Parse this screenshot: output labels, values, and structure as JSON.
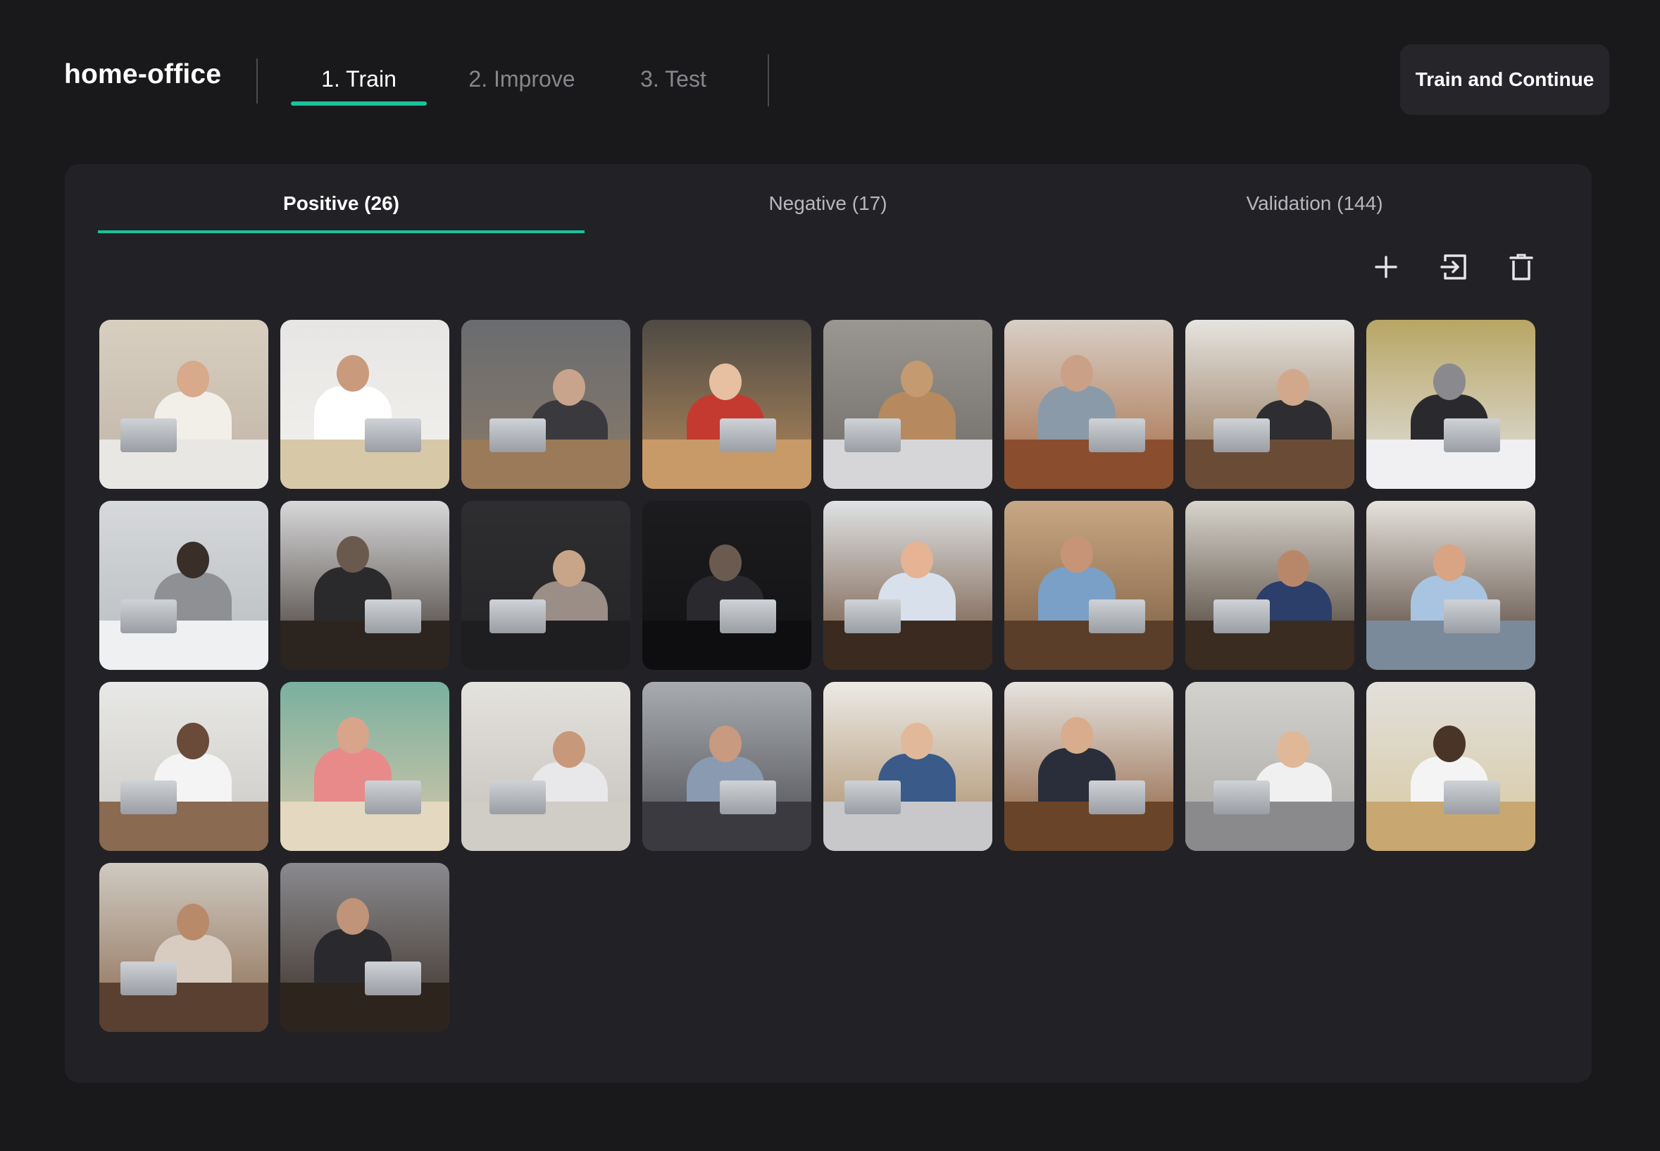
{
  "header": {
    "project_title": "home-office",
    "steps": [
      {
        "label": "1. Train",
        "active": true
      },
      {
        "label": "2. Improve",
        "active": false
      },
      {
        "label": "3. Test",
        "active": false
      }
    ],
    "primary_button": "Train and Continue"
  },
  "tabs": [
    {
      "label": "Positive (26)",
      "active": true
    },
    {
      "label": "Negative (17)",
      "active": false
    },
    {
      "label": "Validation (144)",
      "active": false
    }
  ],
  "toolbar": {
    "add_icon": "plus-icon",
    "import_icon": "import-icon",
    "delete_icon": "trash-icon"
  },
  "colors": {
    "background": "#19191b",
    "panel": "#222226",
    "accent": "#19c39b",
    "button": "#26262a"
  },
  "thumbnails": [
    {
      "top": "#d9cfc0",
      "bottom": "#bfb4a6",
      "figure": "#f2efe9",
      "skin": "#d8a98a",
      "desk": "#e9e7e4"
    },
    {
      "top": "#e8e6e4",
      "bottom": "#f3f1ee",
      "figure": "#ffffff",
      "skin": "#c99a7c",
      "desk": "#d7c9a7"
    },
    {
      "top": "#6a6c70",
      "bottom": "#8a7a68",
      "figure": "#3a3a3e",
      "skin": "#c9a48c",
      "desk": "#9a7a58"
    },
    {
      "top": "#4e4a44",
      "bottom": "#b48a5c",
      "figure": "#c43a30",
      "skin": "#e6c0a0",
      "desk": "#c89a68"
    },
    {
      "top": "#9a9690",
      "bottom": "#6e6a66",
      "figure": "#b68a5e",
      "skin": "#c49a70",
      "desk": "#d6d6d8"
    },
    {
      "top": "#d8cfc6",
      "bottom": "#a66a44",
      "figure": "#8a9aa8",
      "skin": "#caa086",
      "desk": "#8a4e2e"
    },
    {
      "top": "#e6e4e0",
      "bottom": "#8a6a4c",
      "figure": "#2e2e32",
      "skin": "#d2a88c",
      "desk": "#6a4c36"
    },
    {
      "top": "#b8a664",
      "bottom": "#e2e2e4",
      "figure": "#2a2a2e",
      "skin": "#8a8a8e",
      "desk": "#f0f0f2"
    },
    {
      "top": "#d6d8da",
      "bottom": "#b8bcc0",
      "figure": "#8e9094",
      "skin": "#3a2e28",
      "desk": "#eef0f2"
    },
    {
      "top": "#d8d8da",
      "bottom": "#3a322c",
      "figure": "#2a2a2c",
      "skin": "#6a5a4e",
      "desk": "#2c241e"
    },
    {
      "top": "#2e2e30",
      "bottom": "#242426",
      "figure": "#9a8e86",
      "skin": "#c8a488",
      "desk": "#1e1e20"
    },
    {
      "top": "#1c1c1e",
      "bottom": "#121214",
      "figure": "#2a2a2e",
      "skin": "#6a5a50",
      "desk": "#0e0e10"
    },
    {
      "top": "#dfe2e4",
      "bottom": "#6a4a34",
      "figure": "#d8e0ec",
      "skin": "#e6b494",
      "desk": "#3a2a20"
    },
    {
      "top": "#c8a884",
      "bottom": "#7a5a3e",
      "figure": "#7aa0c8",
      "skin": "#c89478",
      "desk": "#5a3e2a"
    },
    {
      "top": "#d8d4cc",
      "bottom": "#3e3228",
      "figure": "#2c3e6a",
      "skin": "#b8876a",
      "desk": "#3a2c20"
    },
    {
      "top": "#e6e2dc",
      "bottom": "#4a3a30",
      "figure": "#a8c4e0",
      "skin": "#d8a484",
      "desk": "#7a8a9a"
    },
    {
      "top": "#e8e8e6",
      "bottom": "#cac8c4",
      "figure": "#f4f4f4",
      "skin": "#6a4a38",
      "desk": "#8a6a50"
    },
    {
      "top": "#7ab0a0",
      "bottom": "#d8c8a8",
      "figure": "#e88a8a",
      "skin": "#d8a48a",
      "desk": "#e4d8c0"
    },
    {
      "top": "#e4e2de",
      "bottom": "#c4c0ba",
      "figure": "#e8e8ea",
      "skin": "#c8987a",
      "desk": "#d0ccc6"
    },
    {
      "top": "#a8acb0",
      "bottom": "#4a4a50",
      "figure": "#8a9ab0",
      "skin": "#c89a80",
      "desk": "#3a3a40"
    },
    {
      "top": "#eceae6",
      "bottom": "#a88a64",
      "figure": "#3a5a8a",
      "skin": "#e2b89a",
      "desk": "#c8c8ca"
    },
    {
      "top": "#e6e4e0",
      "bottom": "#8a5a38",
      "figure": "#2a2e3a",
      "skin": "#d8ac8c",
      "desk": "#6a4428"
    },
    {
      "top": "#d4d2ce",
      "bottom": "#a8a6a2",
      "figure": "#f0f0f0",
      "skin": "#e0b898",
      "desk": "#8a8a8c"
    },
    {
      "top": "#e2e0dc",
      "bottom": "#d8c8a0",
      "figure": "#f4f4f4",
      "skin": "#4a3428",
      "desk": "#c8a870"
    },
    {
      "top": "#cfcac2",
      "bottom": "#8a6a4e",
      "figure": "#d8ccc0",
      "skin": "#b88a6a",
      "desk": "#5a4030"
    },
    {
      "top": "#8a8a8e",
      "bottom": "#3a2e26",
      "figure": "#2a2a2e",
      "skin": "#c09478",
      "desk": "#2e241e"
    }
  ]
}
